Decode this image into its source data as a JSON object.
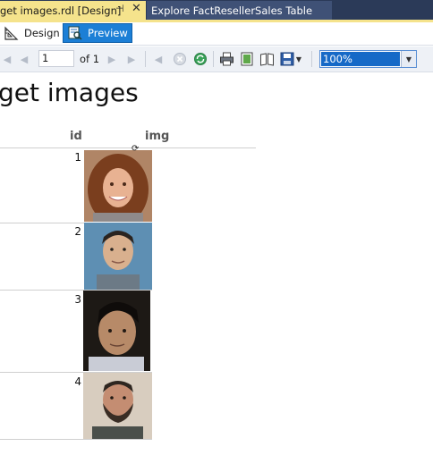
{
  "tabs": {
    "active": {
      "label": "get images.rdl [Design]",
      "pin_icon": "pin-icon",
      "close_icon": "close-icon"
    },
    "inactive": {
      "label": "Explore FactResellerSales Table"
    }
  },
  "modes": {
    "design": {
      "label": "Design",
      "icon": "ruler-triangle-icon"
    },
    "preview": {
      "label": "Preview",
      "icon": "report-preview-icon"
    }
  },
  "viewer": {
    "page_value": "1",
    "of_text": "of",
    "total_pages": "1",
    "zoom": "100%"
  },
  "report": {
    "title": "get images",
    "columns": [
      "id",
      "img"
    ],
    "rows": [
      {
        "id": "1",
        "image": "portrait-woman-curly-hair"
      },
      {
        "id": "2",
        "image": "portrait-man-blue-background"
      },
      {
        "id": "3",
        "image": "portrait-man-dark-background"
      },
      {
        "id": "4",
        "image": "portrait-man-beard"
      }
    ]
  },
  "colors": {
    "tab_strip": "#2b3a58",
    "active_tab": "#f5e38c",
    "preview_button": "#1c7fd6",
    "zoom_highlight": "#1569c7"
  }
}
